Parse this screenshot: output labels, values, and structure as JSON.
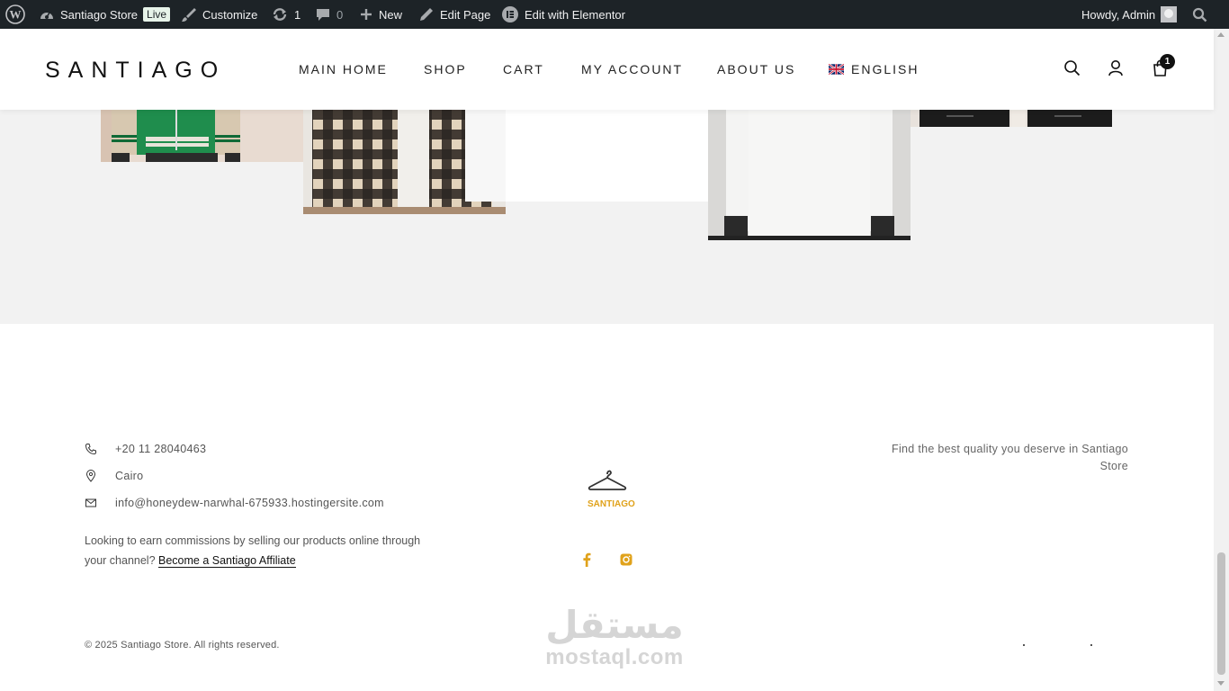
{
  "admin_bar": {
    "site_name": "Santiago Store",
    "live_badge": "Live",
    "customize": "Customize",
    "updates_count": "1",
    "comments_count": "0",
    "new_label": "New",
    "edit_page": "Edit Page",
    "edit_elementor": "Edit with Elementor",
    "howdy": "Howdy, Admin"
  },
  "header": {
    "logo": "SANTIAGO",
    "nav": [
      "MAIN HOME",
      "SHOP",
      "CART",
      "MY ACCOUNT",
      "ABOUT US",
      "ENGLISH"
    ],
    "cart_count": "1"
  },
  "footer": {
    "phone": "+20 11 28040463",
    "city": "Cairo",
    "email": "info@honeydew-narwhal-675933.hostingersite.com",
    "affiliate_text": "Looking to earn commissions by selling our products online through your channel?",
    "affiliate_link": "Become a Santiago Affiliate",
    "tagline": "Find the best quality you deserve in Santiago Store",
    "brand_logo": "SANTIAGO",
    "copyright": "© 2025 Santiago Store. All rights reserved.",
    "accent_color": "#e0a21b"
  },
  "watermark": {
    "arabic": "مستقل",
    "latin": "mostaql.com"
  }
}
